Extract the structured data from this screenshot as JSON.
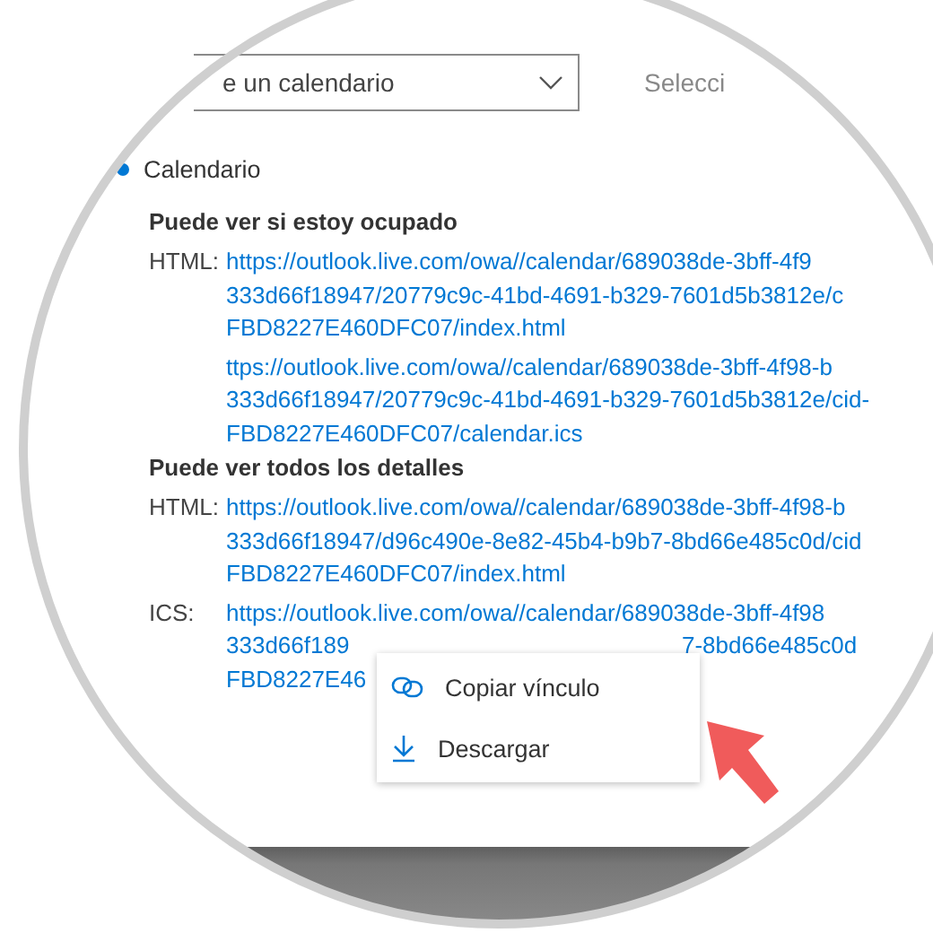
{
  "calendar_picker": {
    "value": "e un calendario"
  },
  "secondary_picker": {
    "placeholder": "Selecci"
  },
  "calendar": {
    "name": "Calendario",
    "selected": true
  },
  "sections": [
    {
      "title": "Puede ver si estoy ocupado",
      "links": [
        {
          "label": "HTML:",
          "lines": [
            [
              "https://outlook.live.com/owa//calendar/689038de-3bff-4f9"
            ],
            [
              "333d66f18947/20779c9c-41bd-4691-b329-7601d5b3812e/c"
            ],
            [
              "FBD8227E460DFC07/index.html"
            ]
          ]
        },
        {
          "lines": [
            [
              "ttps://outlook.live.com/owa//calendar/689038de-3bff-4f98-b"
            ],
            [
              "333d66f18947/20779c9c-41bd-4691-b329-7601d5b3812e/cid-"
            ],
            [
              "FBD8227E460DFC07/calendar.ics"
            ]
          ]
        }
      ]
    },
    {
      "title": "Puede ver todos los detalles",
      "links": [
        {
          "label": "HTML:",
          "lines": [
            [
              "https://outlook.live.com/owa//calendar/689038de-3bff-4f98-b"
            ],
            [
              "333d66f18947/d96c490e-8e82-45b4-b9b7-8bd66e485c0d/cid"
            ],
            [
              "FBD8227E460DFC07/index.html"
            ]
          ]
        },
        {
          "label": "ICS:",
          "lines": [
            [
              "https://outlook.live.com/owa//calendar/689038de-3bff-4f98"
            ],
            [
              "333d66f189",
              "7-8bd66e485c0d"
            ],
            [
              "FBD8227E46"
            ]
          ]
        }
      ]
    }
  ],
  "context_menu": {
    "items": [
      {
        "label": "Copiar vínculo"
      },
      {
        "label": "Descargar"
      }
    ]
  }
}
